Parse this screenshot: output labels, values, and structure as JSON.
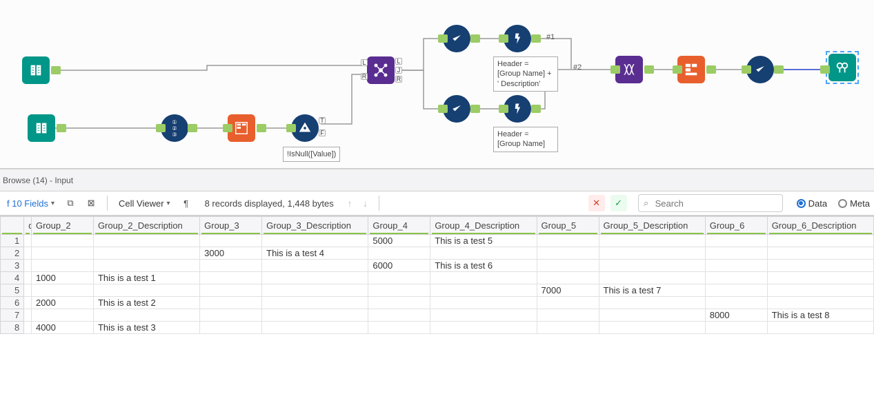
{
  "results_header": "Browse (14) - Input",
  "toolbar": {
    "fields_label": "f 10 Fields",
    "cell_viewer": "Cell Viewer",
    "records_info": "8 records displayed, 1,448 bytes",
    "search_placeholder": "Search",
    "view_data": "Data",
    "view_meta": "Meta"
  },
  "table": {
    "headers": [
      "d",
      "Group_2",
      "Group_2_Description",
      "Group_3",
      "Group_3_Description",
      "Group_4",
      "Group_4_Description",
      "Group_5",
      "Group_5_Description",
      "Group_6",
      "Group_6_Description"
    ],
    "rows": [
      {
        "num": "1",
        "cells": [
          "",
          "",
          "",
          "",
          "",
          "5000",
          "This is a test 5",
          "",
          "",
          "",
          ""
        ]
      },
      {
        "num": "2",
        "cells": [
          "",
          "",
          "",
          "3000",
          "This is a test 4",
          "",
          "",
          "",
          "",
          "",
          ""
        ]
      },
      {
        "num": "3",
        "cells": [
          "",
          "",
          "",
          "",
          "",
          "6000",
          "This is a test 6",
          "",
          "",
          "",
          ""
        ]
      },
      {
        "num": "4",
        "cells": [
          "",
          "1000",
          "This is a test 1",
          "",
          "",
          "",
          "",
          "",
          "",
          "",
          ""
        ]
      },
      {
        "num": "5",
        "cells": [
          "",
          "",
          "",
          "",
          "",
          "",
          "",
          "7000",
          "This is a test 7",
          "",
          ""
        ]
      },
      {
        "num": "6",
        "cells": [
          "",
          "2000",
          "This is a test 2",
          "",
          "",
          "",
          "",
          "",
          "",
          "",
          ""
        ]
      },
      {
        "num": "7",
        "cells": [
          "",
          "",
          "",
          "",
          "",
          "",
          "",
          "",
          "",
          "8000",
          "This is a test 8"
        ]
      },
      {
        "num": "8",
        "cells": [
          "",
          "4000",
          "This is a test 3",
          "",
          "",
          "",
          "",
          "",
          "",
          "",
          ""
        ]
      }
    ]
  },
  "annotations": {
    "filter_expr": "!IsNull([Value])",
    "formula1": "Header = [Group Name] + ' Description'",
    "formula2": "Header = [Group Name]",
    "branch1": "#1",
    "branch2": "#2"
  },
  "join_anchors": {
    "l": "L",
    "j": "J",
    "r": "R"
  }
}
